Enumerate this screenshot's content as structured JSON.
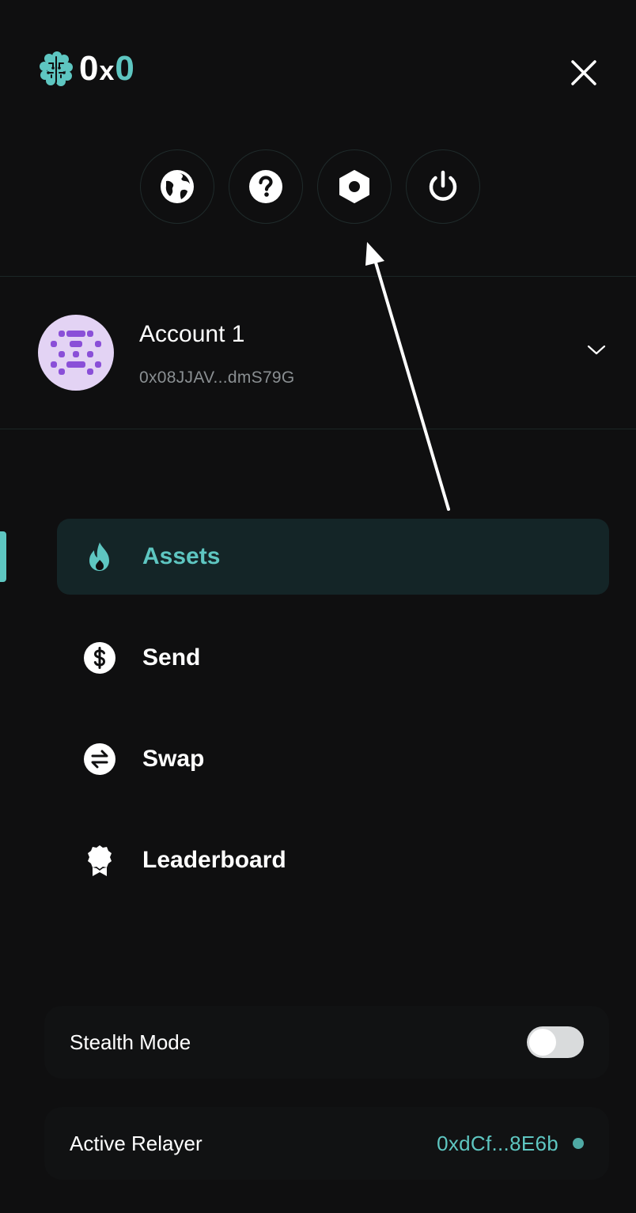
{
  "header": {
    "logo_text_o1": "0",
    "logo_text_x": "x",
    "logo_text_o2": "0",
    "close_icon": "close-icon"
  },
  "quick_actions": [
    {
      "icon": "globe-icon"
    },
    {
      "icon": "help-icon"
    },
    {
      "icon": "settings-hex-icon"
    },
    {
      "icon": "power-icon"
    }
  ],
  "account": {
    "name": "Account 1",
    "address": "0x08JJAV...dmS79G"
  },
  "nav": {
    "items": [
      {
        "label": "Assets",
        "icon": "flame-icon",
        "active": true
      },
      {
        "label": "Send",
        "icon": "dollar-icon",
        "active": false
      },
      {
        "label": "Swap",
        "icon": "swap-icon",
        "active": false
      },
      {
        "label": "Leaderboard",
        "icon": "badge-icon",
        "active": false
      }
    ]
  },
  "stealth": {
    "label": "Stealth Mode",
    "enabled": false
  },
  "relayer": {
    "label": "Active Relayer",
    "address": "0xdCf...8E6b"
  },
  "colors": {
    "background": "#0f0f10",
    "accent": "#5ec6c1",
    "active_nav_bg": "#142527",
    "avatar_bg": "#e3d3f4",
    "avatar_fg": "#8a4fd8"
  }
}
